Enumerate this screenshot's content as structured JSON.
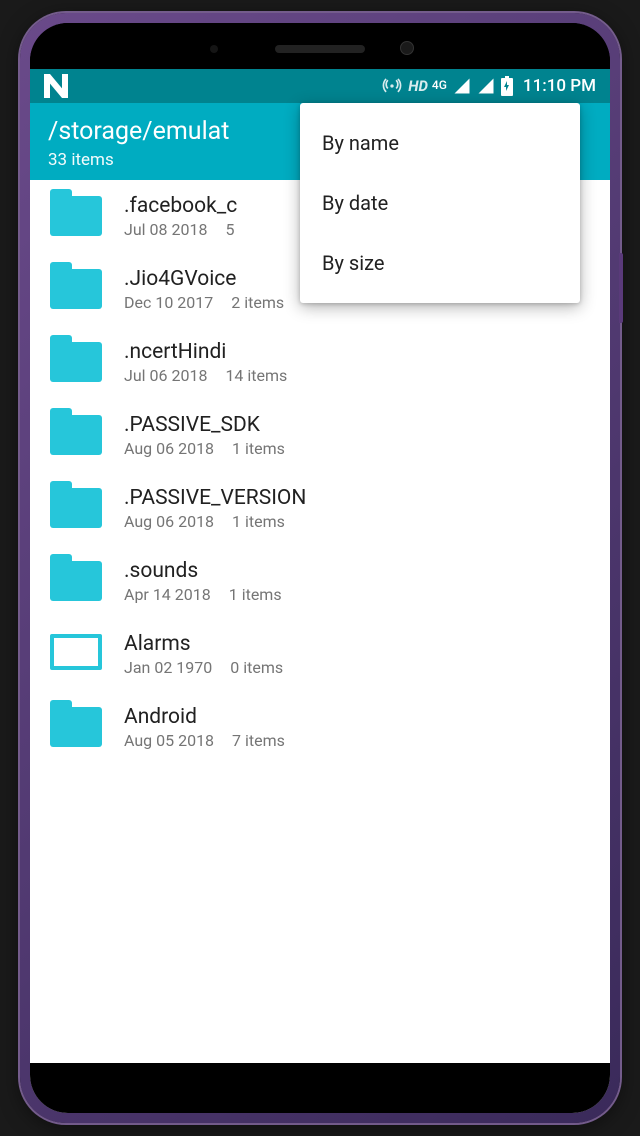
{
  "status": {
    "hd": "HD",
    "network": "4G",
    "time": "11:10 PM"
  },
  "appbar": {
    "title": "/storage/emulat",
    "subtitle": "33 items"
  },
  "popup": {
    "items": [
      "By name",
      "By date",
      "By size"
    ]
  },
  "files": [
    {
      "name": ".facebook_c",
      "date": "Jul 08 2018",
      "count": "5",
      "icon": "filled"
    },
    {
      "name": ".Jio4GVoice",
      "date": "Dec 10 2017",
      "count": "2 items",
      "icon": "filled"
    },
    {
      "name": ".ncertHindi",
      "date": "Jul 06 2018",
      "count": "14 items",
      "icon": "filled"
    },
    {
      "name": ".PASSIVE_SDK",
      "date": "Aug 06 2018",
      "count": "1 items",
      "icon": "filled"
    },
    {
      "name": ".PASSIVE_VERSION",
      "date": "Aug 06 2018",
      "count": "1 items",
      "icon": "filled"
    },
    {
      "name": ".sounds",
      "date": "Apr 14 2018",
      "count": "1 items",
      "icon": "filled"
    },
    {
      "name": "Alarms",
      "date": "Jan 02 1970",
      "count": "0 items",
      "icon": "outline"
    },
    {
      "name": "Android",
      "date": "Aug 05 2018",
      "count": "7 items",
      "icon": "filled"
    }
  ]
}
